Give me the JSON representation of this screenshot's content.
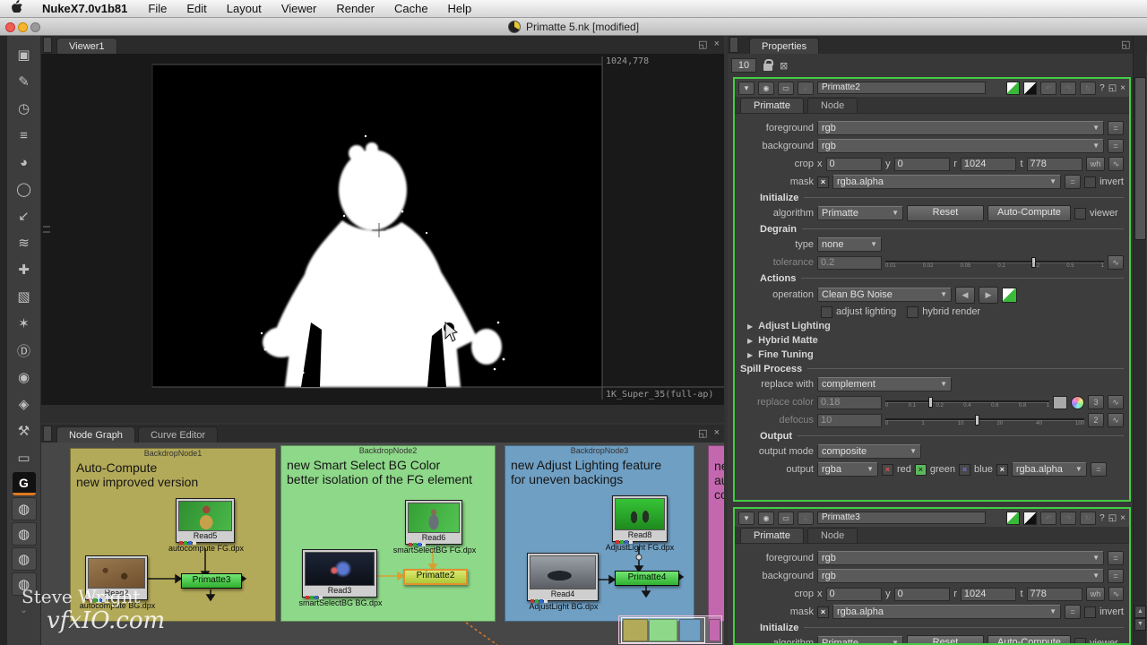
{
  "menu_bar": {
    "app_name": "NukeX7.0v1b81",
    "items": [
      "File",
      "Edit",
      "Layout",
      "Viewer",
      "Render",
      "Cache",
      "Help"
    ]
  },
  "title_bar": {
    "title": "Primatte 5.nk [modified]"
  },
  "toolbar": {
    "glyphs": [
      "▣",
      "✎",
      "◷",
      "≡",
      "◕",
      "◯",
      "↙",
      "≋",
      "✚",
      "▧",
      "✶",
      "Ⓓ",
      "◉",
      "◈",
      "⚒",
      "▭",
      "G",
      "◍",
      "◍",
      "◍",
      "◍",
      "⌄"
    ]
  },
  "viewer": {
    "tab_label": "Viewer1",
    "res_label": "1024,778",
    "format_label": "1K_Super_35(full-ap)"
  },
  "node_graph": {
    "tab_node_graph": "Node Graph",
    "tab_curve_editor": "Curve Editor",
    "backdrops": [
      {
        "name": "BackdropNode1",
        "line1": "Auto-Compute",
        "line2": "new improved version",
        "color": "#b3aa59",
        "fg_read": {
          "name": "Read5",
          "file": "autocompute FG.dpx"
        },
        "bg_read": {
          "name": "Read2",
          "file": "autocompute BG.dpx"
        },
        "keyer": "Primatte3"
      },
      {
        "name": "BackdropNode2",
        "line1": "new Smart Select BG Color",
        "line2": "better isolation of the FG element",
        "color": "#8ed889",
        "fg_read": {
          "name": "Read6",
          "file": "smartSelectBG FG.dpx"
        },
        "bg_read": {
          "name": "Read3",
          "file": "smartSelectBG BG.dpx"
        },
        "keyer": "Primatte2"
      },
      {
        "name": "BackdropNode3",
        "line1": "new Adjust Lighting feature",
        "line2": "for uneven backings",
        "color": "#6f9fc3",
        "fg_read": {
          "name": "Read8",
          "file": "AdjustLight FG.dpx"
        },
        "bg_read": {
          "name": "Read4",
          "file": "AdjustLight BG.dpx"
        },
        "keyer": "Primatte4"
      },
      {
        "name": "",
        "line1": "ne",
        "line2": "au",
        "line3": "co",
        "color": "#c368af"
      }
    ]
  },
  "watermark": {
    "line1": "Steve Wright",
    "line2": "vfxIO.com"
  },
  "props": {
    "tab_label": "Properties",
    "stack_count": "10",
    "accent_green": "#44cc44",
    "selected_orange": "#e0902f",
    "labels": {
      "primatte_tab": "Primatte",
      "node_tab": "Node",
      "foreground": "foreground",
      "background": "background",
      "crop": "crop",
      "x": "x",
      "y": "y",
      "r": "r",
      "t": "t",
      "wh": "wh",
      "mask": "mask",
      "invert": "invert",
      "initialize": "Initialize",
      "algorithm": "algorithm",
      "reset": "Reset",
      "auto_compute": "Auto-Compute",
      "viewer": "viewer",
      "degrain": "Degrain",
      "type": "type",
      "tolerance": "tolerance",
      "actions": "Actions",
      "operation": "operation",
      "adjust_lighting_cb": "adjust lighting",
      "hybrid_render_cb": "hybrid render",
      "adjust_lighting": "Adjust Lighting",
      "hybrid_matte": "Hybrid Matte",
      "fine_tuning": "Fine Tuning",
      "spill_process": "Spill Process",
      "replace_with": "replace with",
      "replace_color": "replace color",
      "defocus": "defocus",
      "output_section": "Output",
      "output_mode": "output mode",
      "output": "output",
      "red": "red",
      "green": "green",
      "blue": "blue",
      "help": "?"
    },
    "p2": {
      "title": "Primatte2",
      "fg": "rgb",
      "bg": "rgb",
      "crop_x": "0",
      "crop_y": "0",
      "crop_r": "1024",
      "crop_t": "778",
      "mask": "rgba.alpha",
      "algorithm": "Primatte",
      "type": "none",
      "tolerance": "0.2",
      "operation": "Clean BG Noise",
      "replace_with": "complement",
      "replace_color": "0.18",
      "defocus": "10",
      "channels3": "3",
      "channels2": "2",
      "output_mode": "composite",
      "output": "rgba",
      "output_mask": "rgba.alpha"
    },
    "p3": {
      "title": "Primatte3",
      "fg": "rgb",
      "bg": "rgb",
      "crop_x": "0",
      "crop_y": "0",
      "crop_r": "1024",
      "crop_t": "778",
      "mask": "rgba.alpha",
      "algorithm": "Primatte"
    },
    "ticks": {
      "tolerance": [
        "0.01",
        "0.02",
        "0.05",
        "0.1",
        "0.2",
        "0.5",
        "1"
      ],
      "replace_color": [
        "0",
        "0.1",
        "0.2",
        "0.4",
        "0.6",
        "0.8",
        "1"
      ],
      "defocus": [
        "0",
        "1",
        "10",
        "20",
        "40",
        "100"
      ]
    }
  },
  "icons": {
    "float": "◱",
    "close": "×",
    "check": "×",
    "left": "◀",
    "right": "▶",
    "curve": "∿",
    "matrix": "=",
    "tri_down": "▼",
    "center": "◉",
    "stamp": "▭",
    "minimize": "⇣",
    "undo": "↶",
    "redo": "↷",
    "revert": "↻"
  }
}
